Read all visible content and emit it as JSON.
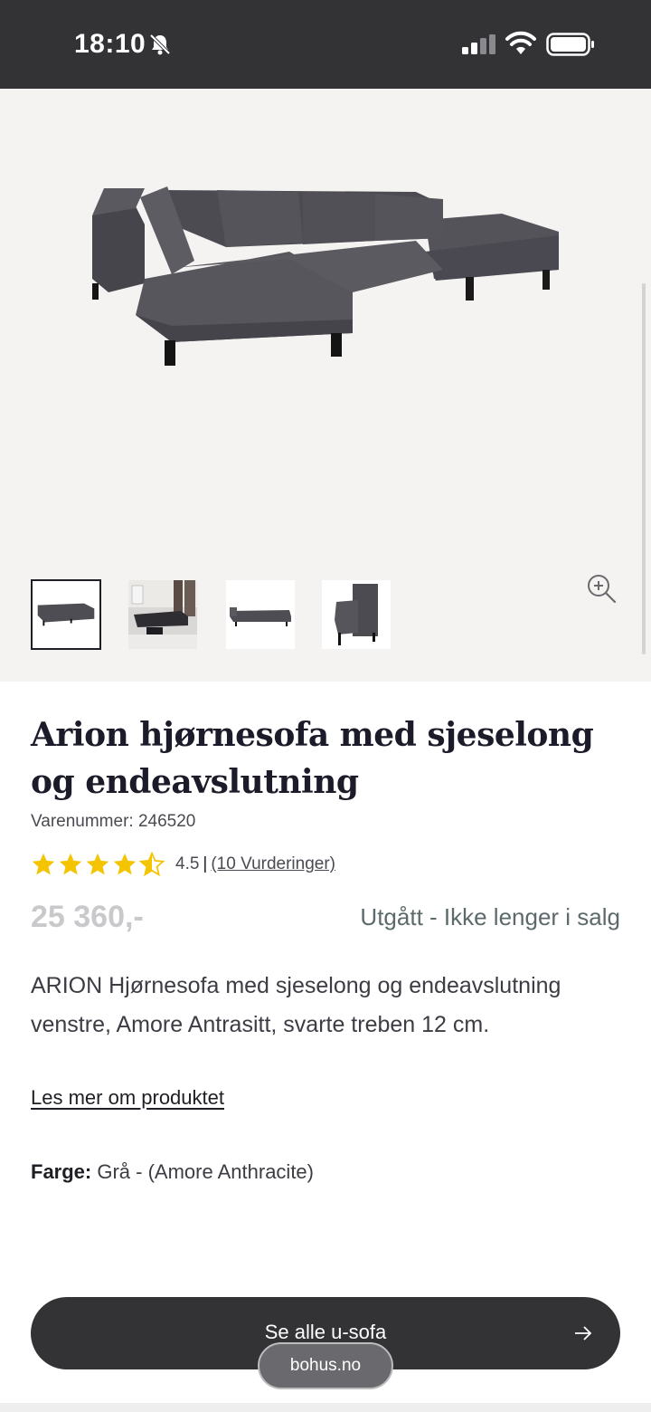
{
  "status_bar": {
    "time": "18:10"
  },
  "gallery": {
    "main_image_alt": "sofa-image",
    "thumbnails": [
      {
        "name": "thumb-sofa-front"
      },
      {
        "name": "thumb-living-room"
      },
      {
        "name": "thumb-sofa-side"
      },
      {
        "name": "thumb-sofa-closeup"
      }
    ]
  },
  "product": {
    "title": "Arion hjørnesofa med sjeselong og endeavslutning",
    "sku": "Varenummer: 246520",
    "rating_value": "4.5",
    "rating_fraction": 0.9,
    "rating_separator": "|",
    "rating_link": "(10 Vurderinger)",
    "price": "25 360,-",
    "availability": "Utgått - Ikke lenger i salg",
    "description": "ARION Hjørnesofa med sjeselong og endeavslutning venstre, Amore Antrasitt, svarte treben 12 cm.",
    "read_more": "Les mer om produktet",
    "color_label": "Farge:",
    "color_value": " Grå - (Amore Anthracite)"
  },
  "cta": {
    "label": "Se alle u-sofa"
  },
  "browser": {
    "url": "bohus.no"
  },
  "colors": {
    "status_bar": "#333336",
    "gallery_bg": "#f4f3f1",
    "star": "#f5c400",
    "cta_bg": "#333336"
  }
}
